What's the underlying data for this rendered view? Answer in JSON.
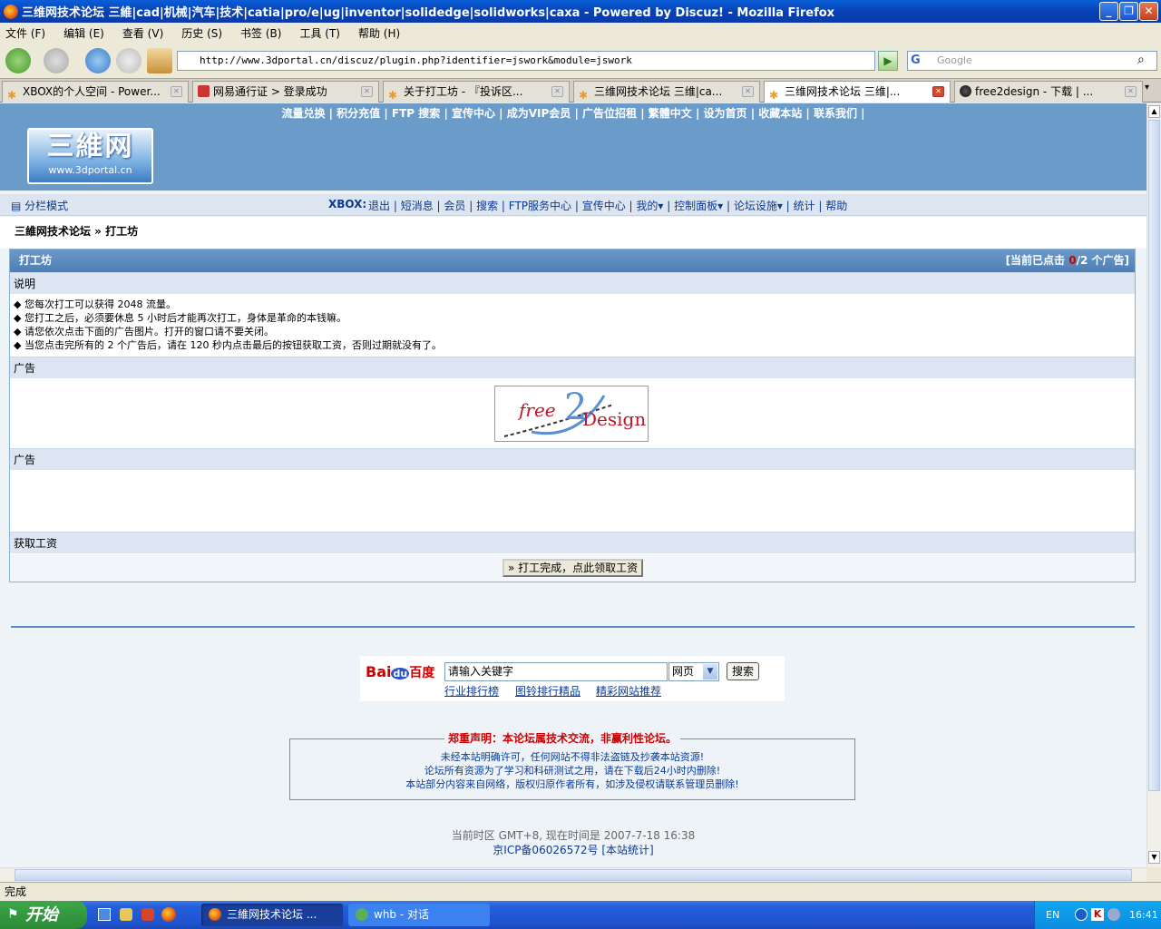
{
  "window": {
    "title": "三维网技术论坛 三維|cad|机械|汽车|技术|catia|pro/e|ug|inventor|solidedge|solidworks|caxa - Powered by Discuz! - Mozilla Firefox"
  },
  "menubar": [
    "文件 (F)",
    "编辑 (E)",
    "查看 (V)",
    "历史 (S)",
    "书签 (B)",
    "工具 (T)",
    "帮助 (H)"
  ],
  "url": "http://www.3dportal.cn/discuz/plugin.php?identifier=jswork&module=jswork",
  "search_placeholder": "Google",
  "tabs": [
    {
      "label": "XBOX的个人空间 - Power..."
    },
    {
      "label": "网易通行证 > 登录成功"
    },
    {
      "label": "关于打工坊 - 『投诉区..."
    },
    {
      "label": "三维网技术论坛 三维|ca..."
    },
    {
      "label": "三维网技术论坛 三维|..."
    },
    {
      "label": "free2design - 下载 | ..."
    }
  ],
  "header": {
    "toplinks": "流量兑换 | 积分充值 | FTP 搜索 | 宣传中心 | 成为VIP会员 | 广告位招租 | 繁體中文 | 设为首页 | 收藏本站 | 联系我们 |",
    "logo_main": "三維网",
    "logo_sub": "www.3dportal.cn"
  },
  "nav": {
    "mode": "分栏模式",
    "user": "XBOX:",
    "items": [
      "退出",
      "短消息",
      "会员",
      "搜索",
      "FTP服务中心",
      "宣传中心",
      "我的",
      "控制面板",
      "论坛设施",
      "统计",
      "帮助"
    ]
  },
  "breadcrumb": "三維网技术论坛 » 打工坊",
  "panel": {
    "title": "打工坊",
    "counter_prefix": "[当前已点击 ",
    "counter_clicked": "0",
    "counter_suffix": "/2 个广告]",
    "section_desc": "说明",
    "bullets": [
      "您每次打工可以获得 2048 流量。",
      "您打工之后，必须要休息 5 小时后才能再次打工，身体是革命的本钱嘛。",
      "请您依次点击下面的广告图片。打开的窗口请不要关闭。",
      "当您点击完所有的 2 个广告后，请在 120 秒内点击最后的按钮获取工资，否则过期就没有了。"
    ],
    "section_ad1": "广告",
    "ad_text_free": "free",
    "ad_text_2": "2",
    "ad_text_design": "Design",
    "section_ad2": "广告",
    "section_salary": "获取工资",
    "salary_button": "» 打工完成，点此领取工资"
  },
  "baidu": {
    "logo_bai": "Bai",
    "logo_du": "du",
    "logo_cn": "百度",
    "input_value": "请输入关键字",
    "select_value": "网页",
    "search_button": "搜索",
    "links": [
      "行业排行榜",
      "图铃排行精品",
      "精彩网站推荐"
    ]
  },
  "notice": {
    "title": "郑重声明：本论坛属技术交流，非赢利性论坛。",
    "lines": [
      "未经本站明确许可，任何网站不得非法盗链及抄袭本站资源!",
      "论坛所有资源为了学习和科研测试之用，请在下载后24小时内删除!",
      "本站部分内容来自网络，版权归原作者所有，如涉及侵权请联系管理员删除!"
    ]
  },
  "footer": {
    "time": "当前时区 GMT+8, 现在时间是 2007-7-18 16:38",
    "icp": "京ICP备06026572号 [本站统计]"
  },
  "status": "完成",
  "taskbar": {
    "start": "开始",
    "items": [
      "三維网技术论坛 ...",
      "whb - 对话"
    ],
    "lang": "EN",
    "clock": "16:41"
  },
  "colors": {
    "accent": "#6b9bc9",
    "highlight_red": "#cc0000",
    "link_blue": "#0a3a95"
  }
}
